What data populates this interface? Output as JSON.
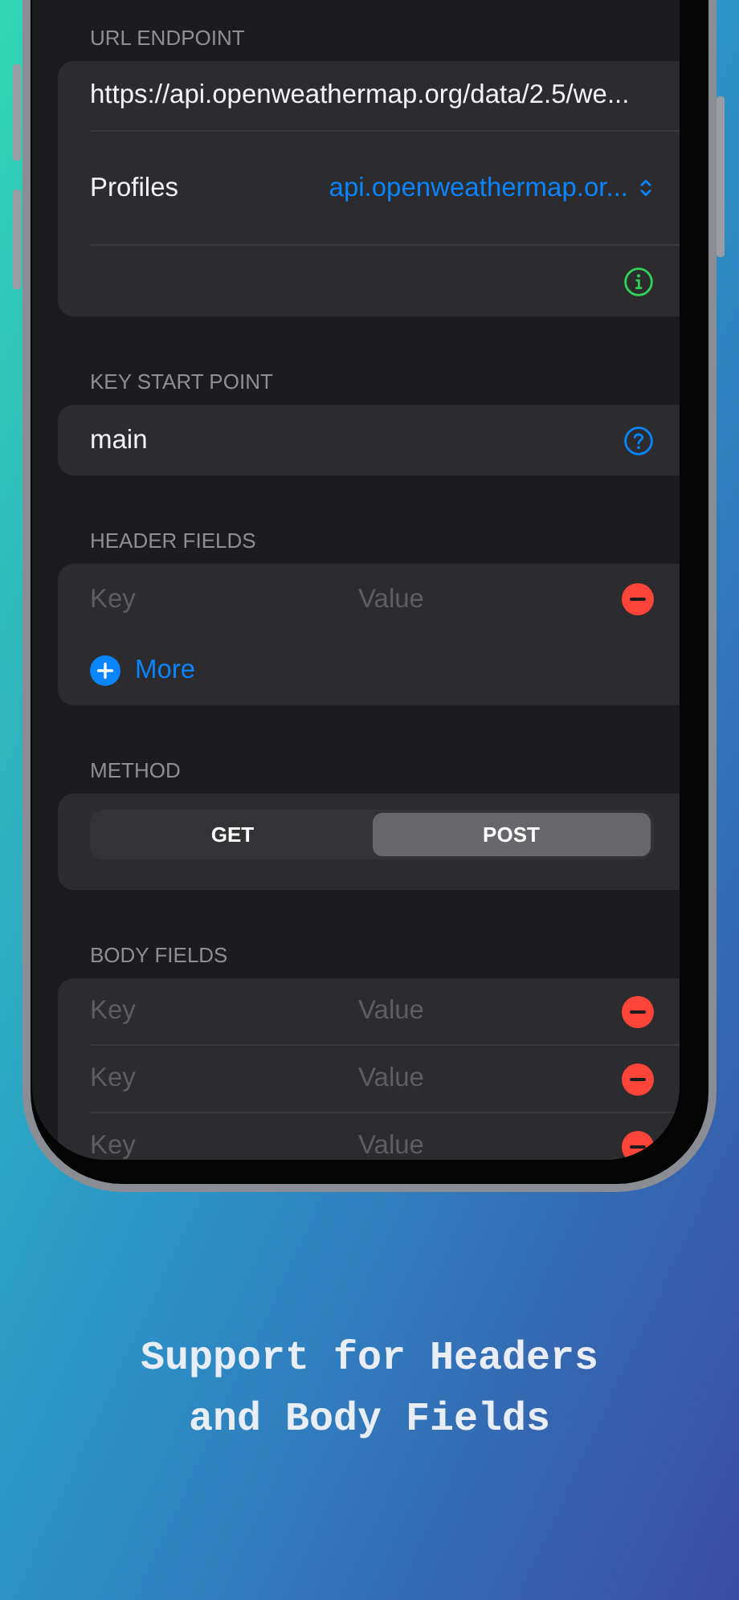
{
  "url_endpoint": {
    "header": "URL ENDPOINT",
    "url": "https://api.openweathermap.org/data/2.5/we...",
    "profiles": {
      "label": "Profiles",
      "value": "api.openweathermap.or..."
    }
  },
  "key_start_point": {
    "header": "KEY START POINT",
    "value": "main"
  },
  "header_fields": {
    "header": "HEADER FIELDS",
    "rows": [
      {
        "key_placeholder": "Key",
        "value_placeholder": "Value"
      }
    ],
    "more": "More"
  },
  "method": {
    "header": "METHOD",
    "options": [
      {
        "label": "GET",
        "selected": false
      },
      {
        "label": "POST",
        "selected": true
      }
    ]
  },
  "body_fields": {
    "header": "BODY FIELDS",
    "rows": [
      {
        "key_placeholder": "Key",
        "value_placeholder": "Value"
      },
      {
        "key_placeholder": "Key",
        "value_placeholder": "Value"
      },
      {
        "key_placeholder": "Key",
        "value_placeholder": "Value"
      }
    ]
  },
  "caption": [
    "Support for Headers",
    "and Body Fields"
  ]
}
